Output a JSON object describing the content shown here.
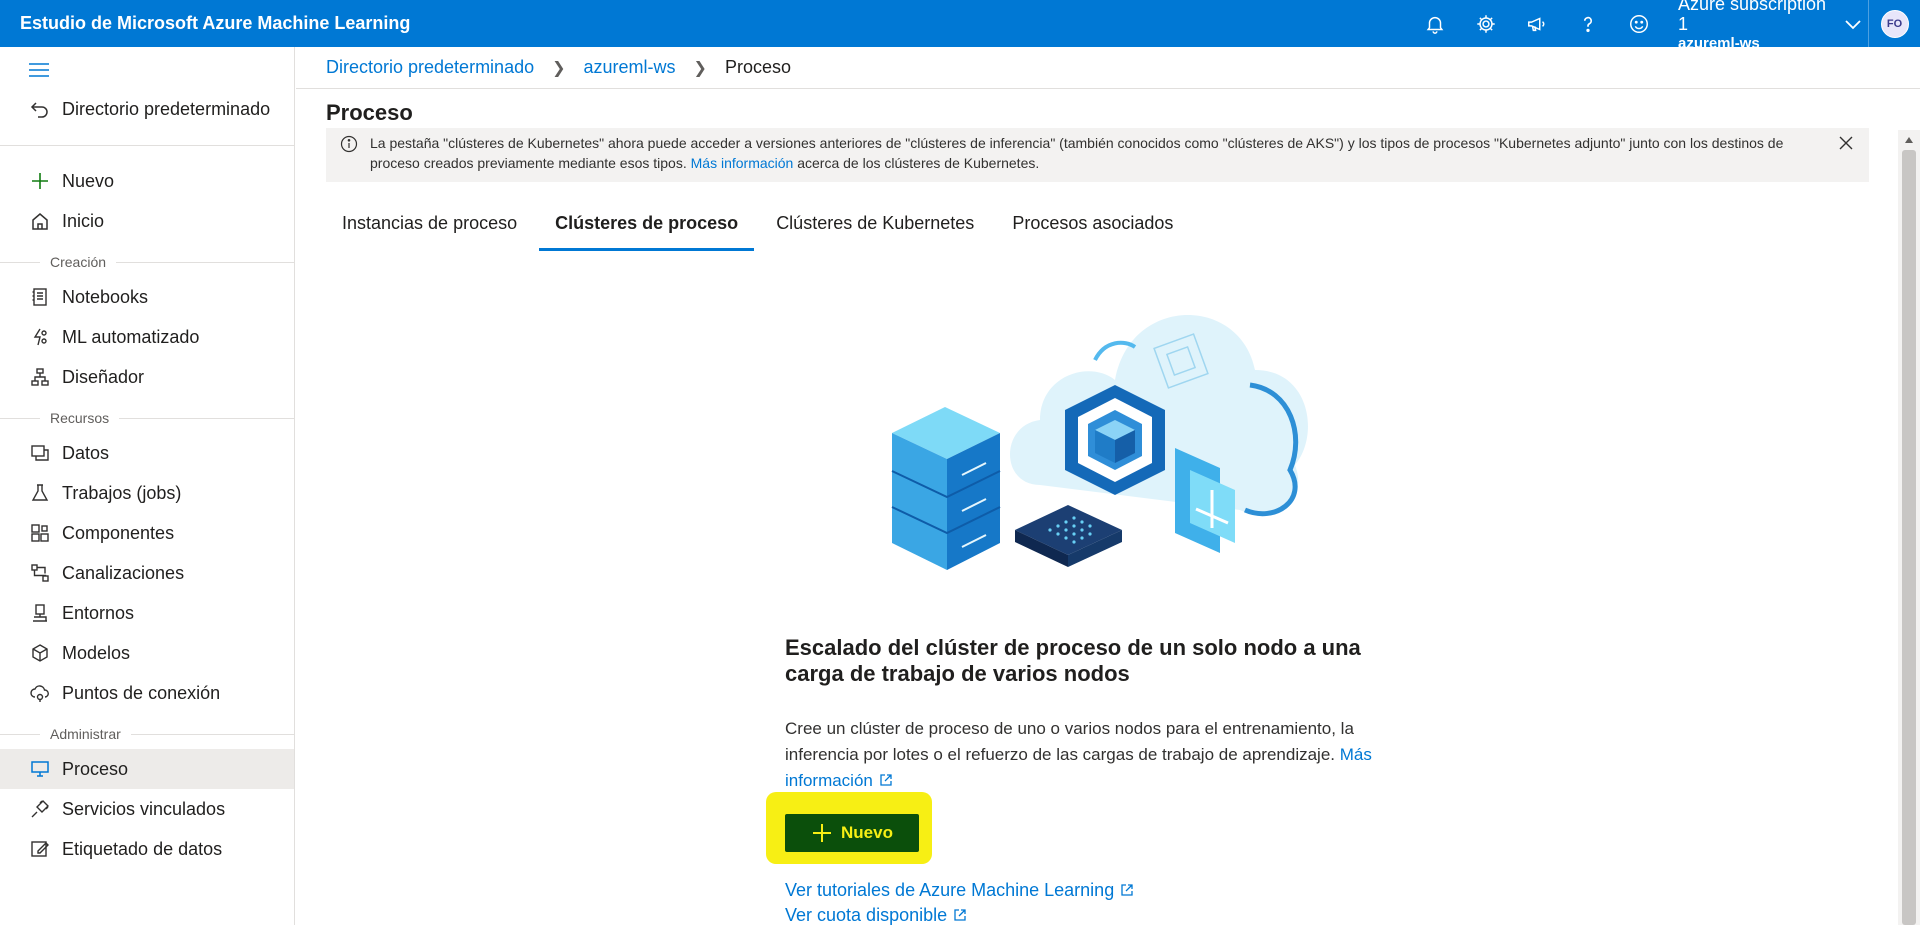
{
  "app": {
    "title": "Estudio de Microsoft Azure Machine Learning",
    "subscription": "Azure subscription 1",
    "workspace": "azureml-ws",
    "avatar_initials": "FO",
    "accent": "#0078d4"
  },
  "top_icons": [
    "bell-icon",
    "gear-icon",
    "megaphone-icon",
    "help-icon",
    "smiley-icon"
  ],
  "sidebar": {
    "back_label": "Directorio predeterminado",
    "new_label": "Nuevo",
    "home_label": "Inicio",
    "section_creation": "Creación",
    "creation_items": [
      "Notebooks",
      "ML automatizado",
      "Diseñador"
    ],
    "section_resources": "Recursos",
    "resource_items": [
      "Datos",
      "Trabajos (jobs)",
      "Componentes",
      "Canalizaciones",
      "Entornos",
      "Modelos",
      "Puntos de conexión"
    ],
    "section_manage": "Administrar",
    "manage_items": [
      "Proceso",
      "Servicios vinculados",
      "Etiquetado de datos"
    ],
    "active_item": "Proceso"
  },
  "breadcrumb": [
    "Directorio predeterminado",
    "azureml-ws",
    "Proceso"
  ],
  "page": {
    "title": "Proceso",
    "banner_text": "La pestaña \"clústeres de Kubernetes\" ahora puede acceder a versiones anteriores de \"clústeres de inferencia\" (también conocidos como \"clústeres de AKS\") y los tipos de procesos \"Kubernetes adjunto\" junto con los destinos de proceso creados previamente mediante esos tipos.",
    "banner_link": "Más información",
    "banner_suffix": "acerca de los clústeres de Kubernetes.",
    "tabs": [
      "Instancias de proceso",
      "Clústeres de proceso",
      "Clústeres de Kubernetes",
      "Procesos asociados"
    ],
    "active_tab": "Clústeres de proceso"
  },
  "empty_state": {
    "title": "Escalado del clúster de proceso de un solo nodo a una carga de trabajo de varios nodos",
    "description": "Cree un clúster de proceso de uno o varios nodos para el entrenamiento, la inferencia por lotes o el refuerzo de las cargas de trabajo de aprendizaje.",
    "more_info": "Más información",
    "new_button": "Nuevo",
    "tutorials_link": "Ver tutoriales de Azure Machine Learning",
    "quota_link": "Ver cuota disponible",
    "highlight_color": "#f7ef14"
  }
}
